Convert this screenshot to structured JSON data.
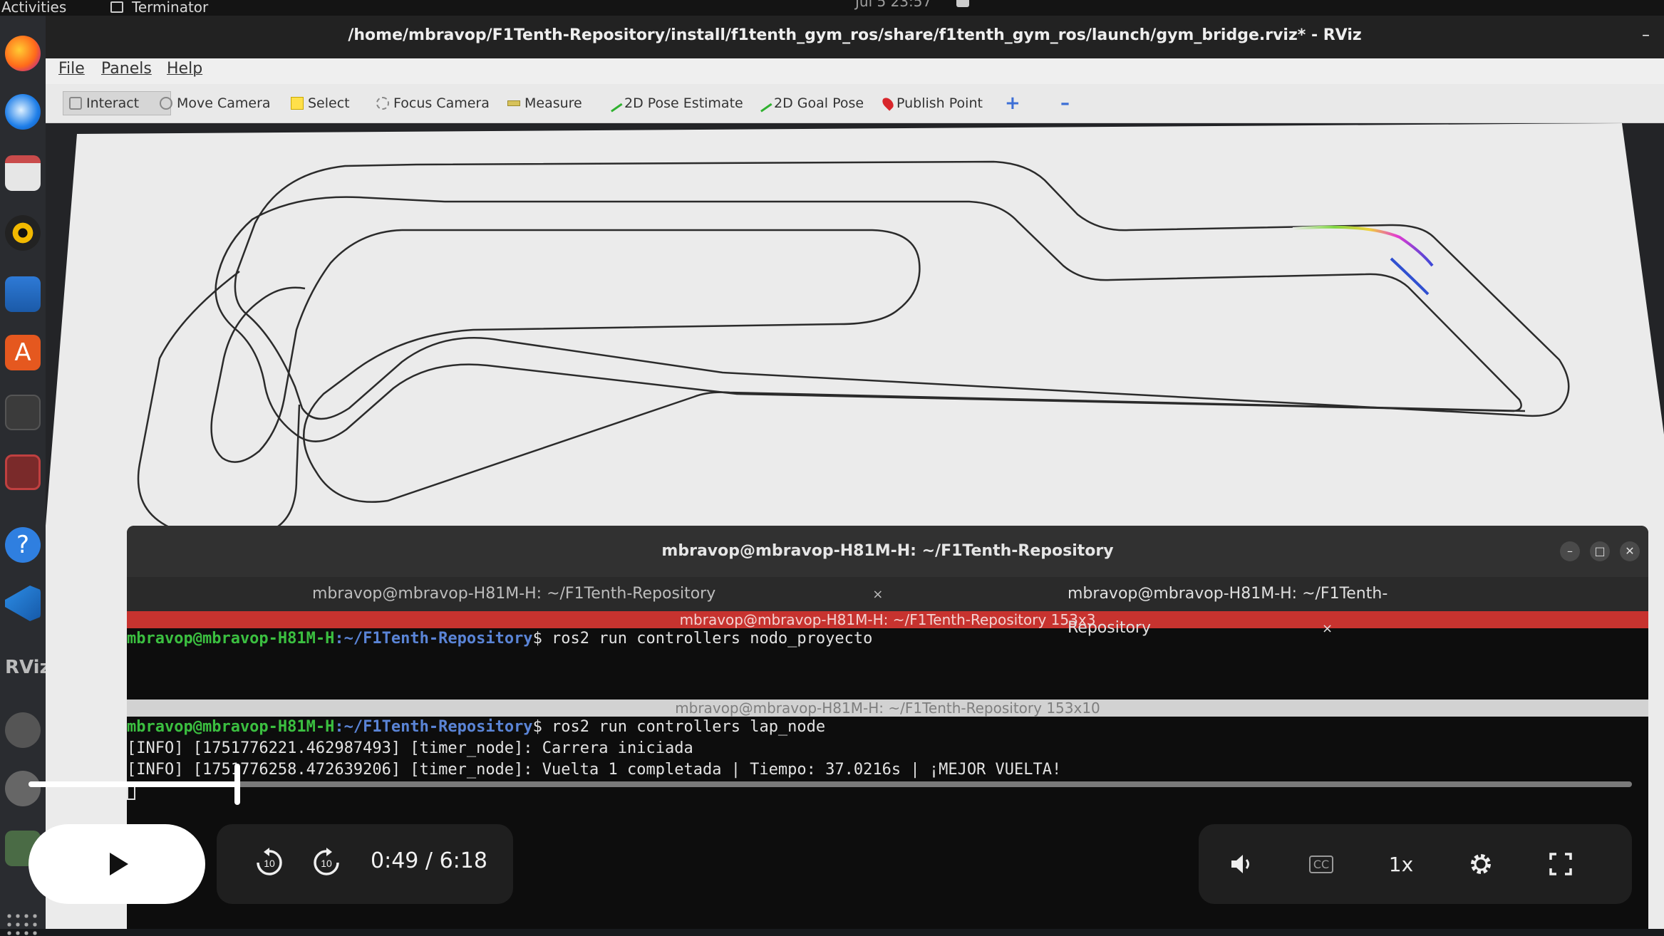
{
  "os": {
    "activities": "Activities",
    "app": "Terminator",
    "clock": "Jul 5 23:57"
  },
  "dock": {
    "items": [
      "firefox-icon",
      "thunderbird-icon",
      "files-icon",
      "rhythmbox-icon",
      "writer-icon",
      "software-icon",
      "terminal-icon",
      "app-icon",
      "help-icon",
      "vscode-icon",
      "rviz-icon",
      "disc-icon",
      "trash-icon",
      "grid-icon"
    ],
    "rviz_label": "RViz"
  },
  "rviz": {
    "title": "/home/mbravop/F1Tenth-Repository/install/f1tenth_gym_ros/share/f1tenth_gym_ros/launch/gym_bridge.rviz* - RViz",
    "menu": [
      "File",
      "Panels",
      "Help"
    ],
    "tools": [
      "Interact",
      "Move Camera",
      "Select",
      "Focus Camera",
      "Measure",
      "2D Pose Estimate",
      "2D Goal Pose",
      "Publish Point"
    ]
  },
  "terminal": {
    "title": "mbravop@mbravop-H81M-H: ~/F1Tenth-Repository",
    "tabs": [
      "mbravop@mbravop-H81M-H: ~/F1Tenth-Repository",
      "mbravop@mbravop-H81M-H: ~/F1Tenth-Repository"
    ],
    "pane1_header": "mbravop@mbravop-H81M-H: ~/F1Tenth-Repository 153x3",
    "prompt_user": "mbravop@mbravop-H81M-H",
    "prompt_path": ":~/F1Tenth-Repository",
    "pane1_cmd": "$ ros2 run controllers nodo_proyecto",
    "pane2_header": "mbravop@mbravop-H81M-H: ~/F1Tenth-Repository 153x10",
    "pane2_cmd": "$ ros2 run controllers lap_node",
    "log1": "[INFO] [1751776221.462987493] [timer_node]: Carrera iniciada",
    "log2": "[INFO] [1751776258.472639206] [timer_node]: Vuelta 1 completada | Tiempo: 37.0216s | ¡MEJOR VUELTA!"
  },
  "player": {
    "current": "0:49",
    "separator": " / ",
    "duration": "6:18",
    "speed": "1x",
    "progress": 0.13,
    "skip_back": "10",
    "skip_forward": "10",
    "cc": "CC"
  }
}
